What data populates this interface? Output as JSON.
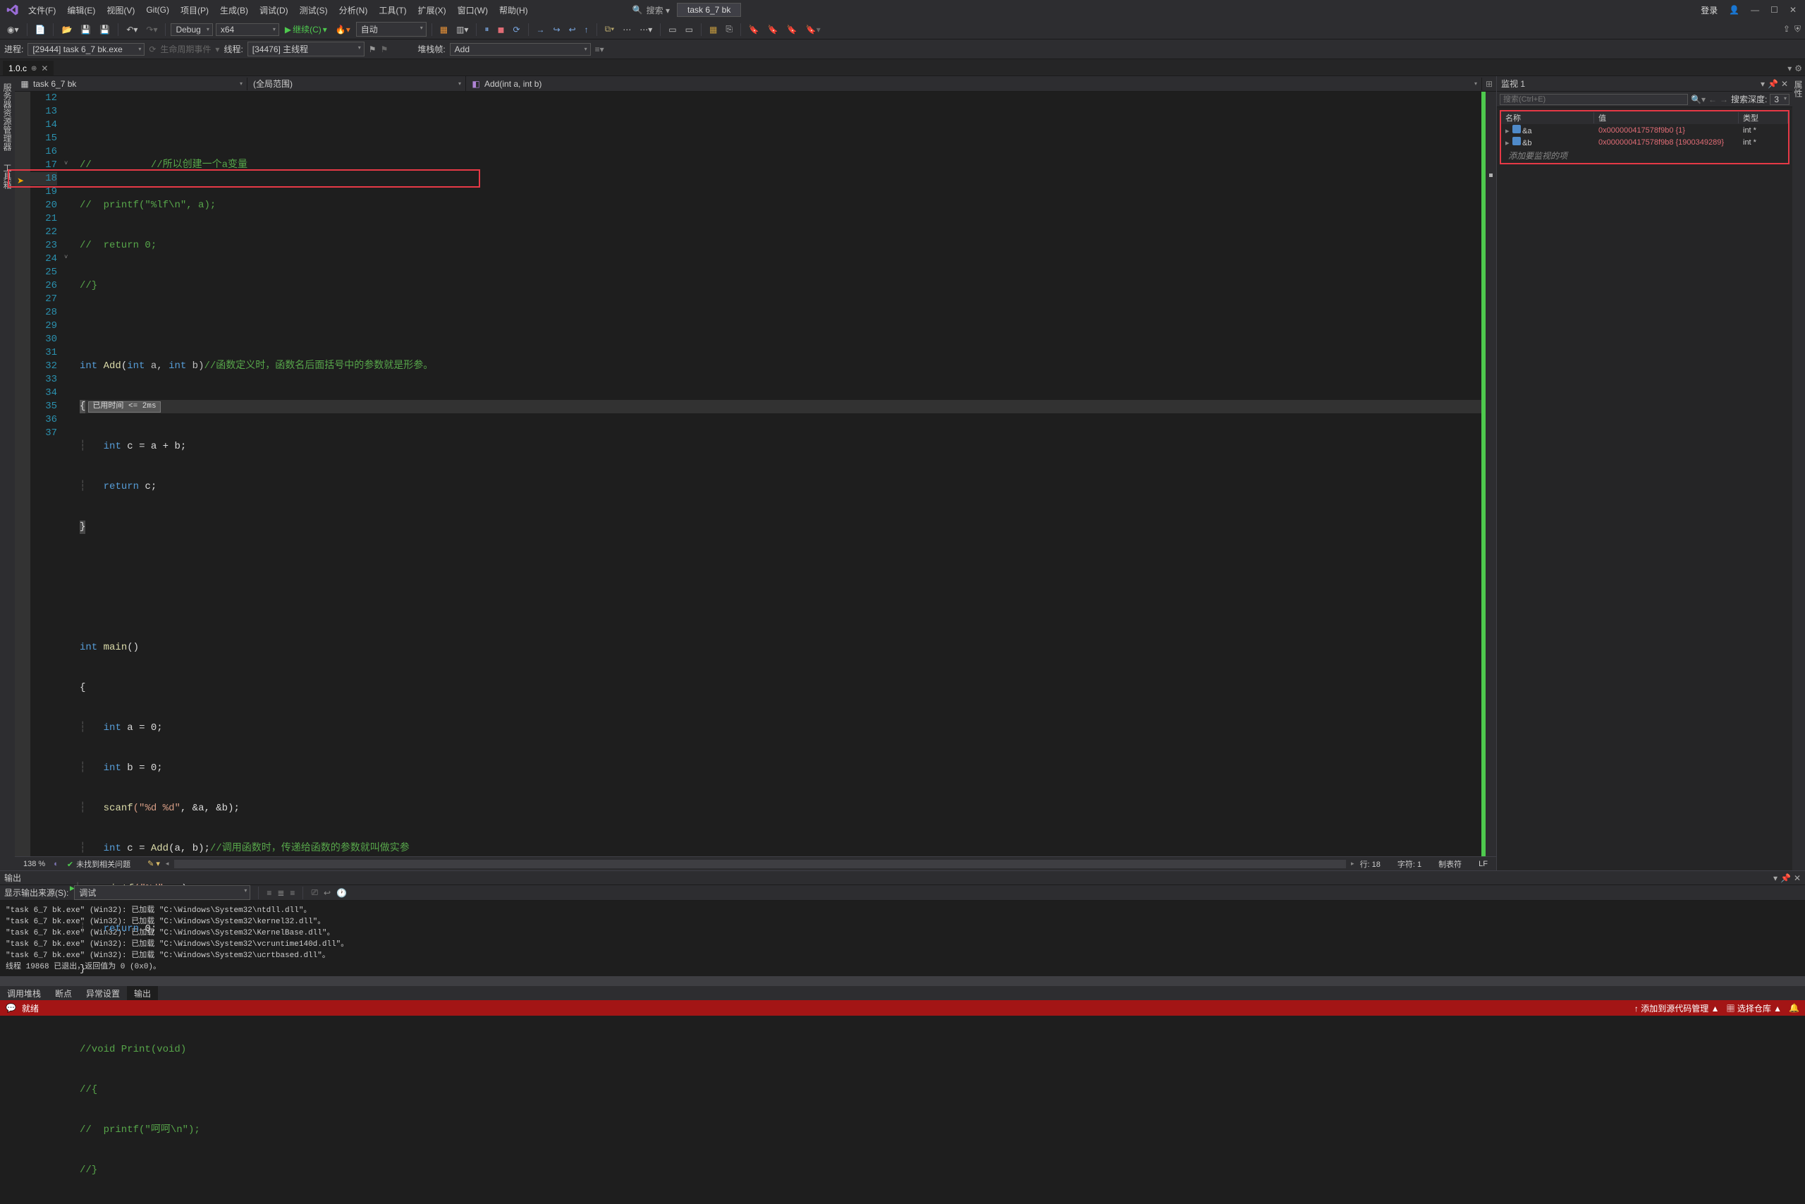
{
  "menubar": {
    "file": "文件(F)",
    "edit": "编辑(E)",
    "view": "视图(V)",
    "git": "Git(G)",
    "project": "项目(P)",
    "build": "生成(B)",
    "debug": "调试(D)",
    "test": "测试(S)",
    "analyze": "分析(N)",
    "tools": "工具(T)",
    "extensions": "扩展(X)",
    "window": "窗口(W)",
    "help": "帮助(H)"
  },
  "titlebar": {
    "search": "搜索 ▾",
    "solution": "task 6_7 bk",
    "signin": "登录"
  },
  "toolbar": {
    "config": "Debug",
    "platform": "x64",
    "continue": "继续(C)",
    "auto": "自动"
  },
  "processbar": {
    "proc_lbl": "进程:",
    "proc": "[29444] task 6_7 bk.exe",
    "life_lbl": "生命周期事件",
    "thread_lbl": "线程:",
    "thread": "[34476] 主线程",
    "stack_lbl": "堆栈帧:",
    "stack": "Add"
  },
  "doctab": {
    "name": "1.0.c"
  },
  "navbar": {
    "project": "task 6_7 bk",
    "scope": "(全局范围)",
    "func": "Add(int a, int b)"
  },
  "lines": {
    "n12": "12",
    "n13": "13",
    "n14": "14",
    "n15": "15",
    "n16": "16",
    "n17": "17",
    "n18": "18",
    "n19": "19",
    "n20": "20",
    "n21": "21",
    "n22": "22",
    "n23": "23",
    "n24": "24",
    "n25": "25",
    "n26": "26",
    "n27": "27",
    "n28": "28",
    "n29": "29",
    "n30": "30",
    "n31": "31",
    "n32": "32",
    "n33": "33",
    "n34": "34",
    "n35": "35",
    "n36": "36",
    "n37": "37"
  },
  "code": {
    "l12": "//          //所以创建一个a变量",
    "l13a": "//  ",
    "l13b": "printf",
    "l13c": "(\"%lf\\n\", a);",
    "l14": "//  return 0;",
    "l15": "//}",
    "l17_int": "int ",
    "l17_add": "Add",
    "l17_sig": "(",
    "l17_p1": "int",
    "l17_a": " a, ",
    "l17_p2": "int",
    "l17_b": " b)",
    "l17_c": "//函数定义时，函数名后面括号中的参数就是形参。",
    "l18_brace": "{",
    "l18_time": "已用时间 <= 2ms",
    "l19_int": "int",
    "l19_rest": " c = a + b;",
    "l20_ret": "return",
    "l20_rest": " c;",
    "l21": "}",
    "l24_int": "int ",
    "l24_main": "main",
    "l24_p": "()",
    "l25": "{",
    "l26_int": "int",
    "l26_rest": " a = 0;",
    "l27_int": "int",
    "l27_rest": " b = 0;",
    "l28_fn": "scanf",
    "l28_s": "(\"%d %d\"",
    "l28_r": ", &a, &b);",
    "l29_int": "int",
    "l29_mid": " c = ",
    "l29_fn": "Add",
    "l29_arg": "(a, b);",
    "l29_c": "//调用函数时，传递给函数的参数就叫做实参",
    "l30_fn": "printf",
    "l30_s": "(\"%d\"",
    "l30_r": ", c);",
    "l31_ret": "return",
    "l31_rest": " 0;",
    "l32": "}",
    "l34": "//void Print(void)",
    "l35": "//{",
    "l36": "//  printf(\"呵呵\\n\");",
    "l37": "//}"
  },
  "editor_footer": {
    "zoom": "138 %",
    "warn": "未找到相关问题",
    "line": "行: 18",
    "char": "字符: 1",
    "tabs": "制表符",
    "eol": "LF"
  },
  "watch": {
    "title": "监视 1",
    "search_ph": "搜索(Ctrl+E)",
    "depth_lbl": "搜索深度:",
    "depth": "3",
    "h_name": "名称",
    "h_val": "值",
    "h_type": "类型",
    "r1_name": "&a",
    "r1_val": "0x000000417578f9b0 {1}",
    "r1_type": "int *",
    "r2_name": "&b",
    "r2_val": "0x000000417578f9b8 {1900349289}",
    "r2_type": "int *",
    "adder": "添加要监视的项"
  },
  "side_tabs": {
    "toolbox": "工具箱",
    "server": "服务器资源管理器",
    "props": "属性"
  },
  "output": {
    "title": "输出",
    "src_lbl": "显示输出来源(S):",
    "src": "调试",
    "l1": "\"task 6_7 bk.exe\" (Win32): 已加载 \"C:\\Windows\\System32\\ntdll.dll\"。",
    "l2": "\"task 6_7 bk.exe\" (Win32): 已加载 \"C:\\Windows\\System32\\kernel32.dll\"。",
    "l3": "\"task 6_7 bk.exe\" (Win32): 已加载 \"C:\\Windows\\System32\\KernelBase.dll\"。",
    "l4": "\"task 6_7 bk.exe\" (Win32): 已加载 \"C:\\Windows\\System32\\vcruntime140d.dll\"。",
    "l5": "\"task 6_7 bk.exe\" (Win32): 已加载 \"C:\\Windows\\System32\\ucrtbased.dll\"。",
    "l6": "线程 19868 已退出，返回值为 0 (0x0)。"
  },
  "bottom_tabs": {
    "stack": "调用堆栈",
    "bp": "断点",
    "ex": "异常设置",
    "out": "输出"
  },
  "status": {
    "ready": "就绪",
    "git": "添加到源代码管理 ▲",
    "repo": "选择仓库 ▲"
  }
}
